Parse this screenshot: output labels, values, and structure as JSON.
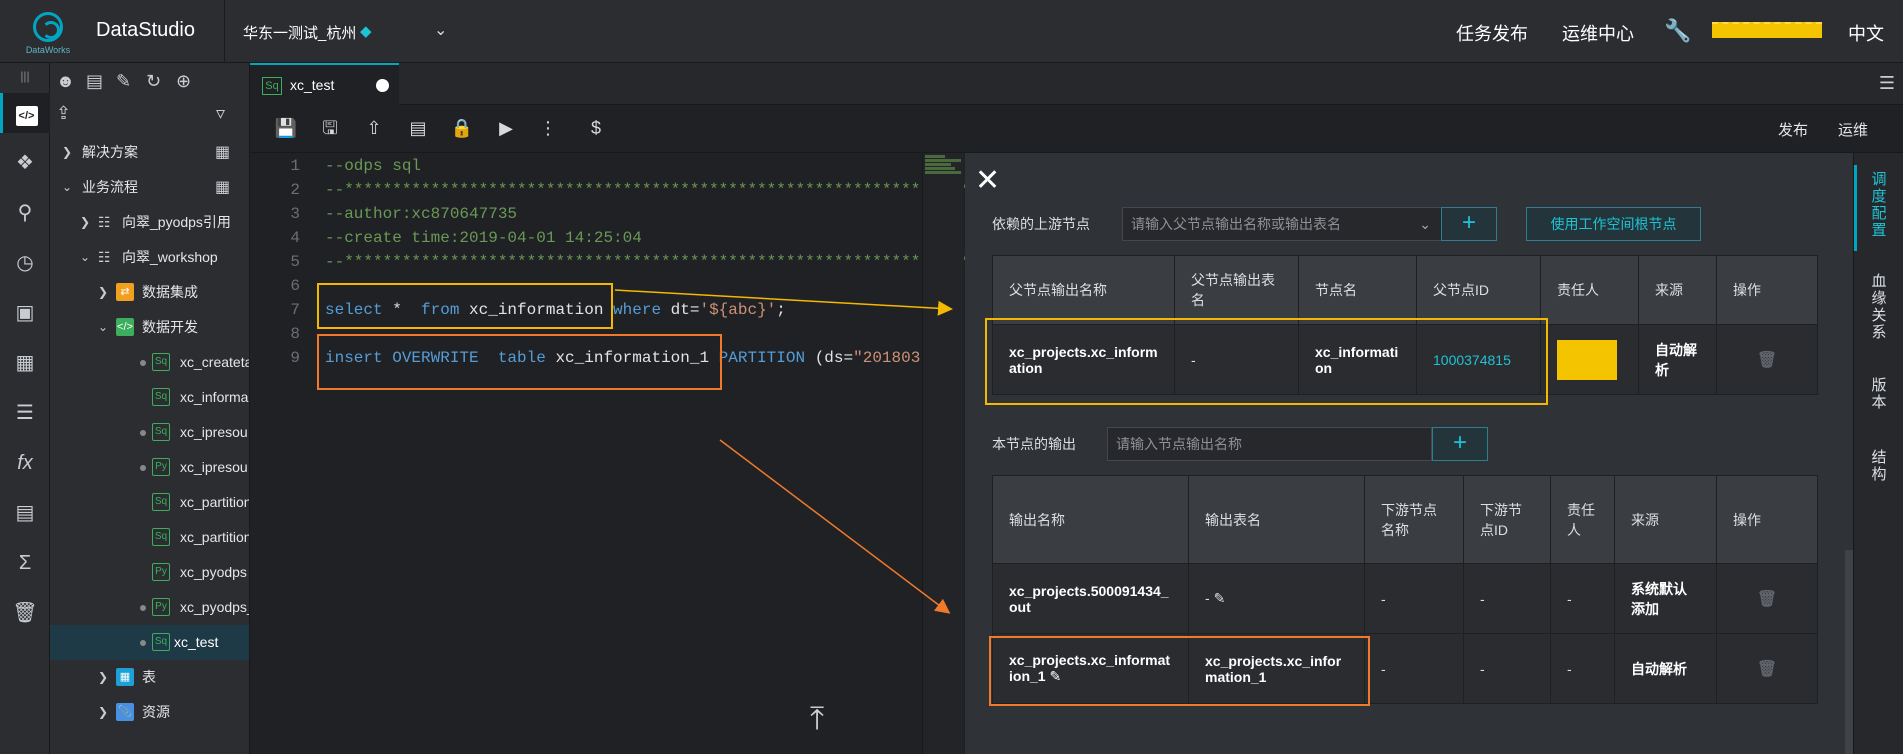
{
  "header": {
    "logo_text": "DataWorks",
    "app_title": "DataStudio",
    "region": "华东一测试_杭州",
    "links": [
      "任务发布",
      "运维中心"
    ],
    "language": "中文"
  },
  "tree": {
    "items": [
      {
        "label": "解决方案"
      },
      {
        "label": "业务流程"
      },
      {
        "label": "向翠_pyodps引用"
      },
      {
        "label": "向翠_workshop"
      },
      {
        "label": "数据集成"
      },
      {
        "label": "数据开发"
      },
      {
        "label": "xc_createta",
        "type": "Sq"
      },
      {
        "label": "xc_informa",
        "type": "Sq"
      },
      {
        "label": "xc_ipresou",
        "type": "Sq"
      },
      {
        "label": "xc_ipresou",
        "type": "Py"
      },
      {
        "label": "xc_partition",
        "type": "Sq"
      },
      {
        "label": "xc_partition",
        "type": "Sq"
      },
      {
        "label": "xc_pyodps",
        "type": "Py"
      },
      {
        "label": "xc_pyodps_",
        "type": "Py"
      },
      {
        "label": "xc_test",
        "type": "Sq"
      },
      {
        "label": "表"
      },
      {
        "label": "资源"
      }
    ]
  },
  "tab": {
    "icon": "Sq",
    "name": "xc_test"
  },
  "toolbar": {
    "publish": "发布",
    "ops": "运维"
  },
  "editor": {
    "lines": [
      "1",
      "2",
      "3",
      "4",
      "5",
      "6",
      "7",
      "8",
      "9"
    ],
    "code": {
      "l1": "--odps sql",
      "l2": "--**********************************************************************",
      "l3": "--author:xc870647735",
      "l4": "--create time:2019-04-01 14:25:04",
      "l5": "--**********************************************************************",
      "l7_kw1": "select",
      "l7_t1": " *  ",
      "l7_kw2": "from",
      "l7_t2": " xc_information ",
      "l7_kw3": "where",
      "l7_t3": " dt=",
      "l7_str": "'${abc}'",
      "l7_t4": ";",
      "l9_kw1": "insert OVERWRITE  table",
      "l9_t1": " xc_information_1 ",
      "l9_kw2": "PARTITION",
      "l9_t2": " (ds=",
      "l9_str": "\"201803"
    }
  },
  "panel": {
    "upstream_label": "依赖的上游节点",
    "upstream_placeholder": "请输入父节点输出名称或输出表名",
    "use_root_button": "使用工作空间根节点",
    "upstream_headers": [
      "父节点输出名称",
      "父节点输出表名",
      "节点名",
      "父节点ID",
      "责任人",
      "来源",
      "操作"
    ],
    "upstream_rows": [
      {
        "output_name": "xc_projects.xc_information",
        "table": "-",
        "node_name": "xc_information",
        "node_id": "1000374815",
        "source": "自动解析"
      }
    ],
    "output_label": "本节点的输出",
    "output_placeholder": "请输入节点输出名称",
    "output_headers": [
      "输出名称",
      "输出表名",
      "下游节点名称",
      "下游节点ID",
      "责任人",
      "来源",
      "操作"
    ],
    "output_rows": [
      {
        "output_name": "xc_projects.500091434_out",
        "table": "-",
        "downstream_name": "-",
        "downstream_id": "-",
        "owner": "-",
        "source": "系统默认添加"
      },
      {
        "output_name": "xc_projects.xc_information_1",
        "table": "xc_projects.xc_information_1",
        "downstream_name": "-",
        "downstream_id": "-",
        "owner": "-",
        "source": "自动解析"
      }
    ]
  },
  "side_tabs": [
    "调度配置",
    "血缘关系",
    "版本",
    "结构"
  ],
  "colors": {
    "accent": "#00a6c2",
    "highlight_yellow": "#f5b800",
    "highlight_orange": "#f07a2a"
  }
}
